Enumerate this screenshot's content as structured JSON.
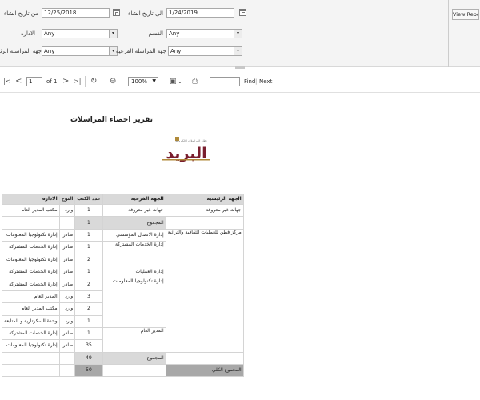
{
  "params": {
    "from_date_label": "من تاريخ انشاء",
    "from_date_value": "12/25/2018",
    "to_date_label": "الى تاريخ انشاء",
    "to_date_value": "1/24/2019",
    "department_label": "الاداره",
    "department_value": "Any",
    "section_label": "القسم",
    "section_value": "Any",
    "main_party_label": "جهه المراسله الرئيسيه",
    "main_party_value": "Any",
    "sub_party_label": "جهه المراسله الفرعيه",
    "sub_party_value": "Any",
    "view_report_label": "View Report"
  },
  "toolbar": {
    "first_page": "|<",
    "prev_page": "<",
    "page_value": "1",
    "of_label": "of 1",
    "next_page": ">",
    "last_page": ">|",
    "zoom_value": "100%",
    "find_label": "Find",
    "divider": "|",
    "next_label": "Next"
  },
  "report": {
    "title": "تقرير احصاء المراسلات",
    "logo_subtitle": "نظام المراسلات الالكترونية",
    "logo_text": "البريد",
    "headers": [
      "الجهة الرئيسية",
      "الجهة الفرعية",
      "عدد الكتب",
      "النوع",
      "الاداره"
    ],
    "rows": [
      {
        "main": "جهات غير معروفة",
        "sub": "جهات غير معروفة",
        "count": "1",
        "type": "وارد",
        "dept": "مكتب المدير العام"
      },
      {
        "summary": true,
        "label": "المجموع",
        "count": "1"
      },
      {
        "main": "مركز فطن للعمليات الثقافية والتراثية",
        "sub": "إدارة الاتصال المؤسسي",
        "count": "1",
        "type": "صادر",
        "dept": "إدارة تكنولوجيا المعلومات"
      },
      {
        "main": "",
        "sub": "إدارة الخدمات المشتركة",
        "count": "1",
        "type": "صادر",
        "dept": "إدارة الخدمات المشتركة"
      },
      {
        "main": "",
        "sub": "",
        "count": "2",
        "type": "صادر",
        "dept": "إدارة تكنولوجيا المعلومات"
      },
      {
        "main": "",
        "sub": "إدارة العمليات",
        "count": "1",
        "type": "صادر",
        "dept": "إدارة الخدمات المشتركة"
      },
      {
        "main": "",
        "sub": "إدارة تكنولوجيا المعلومات",
        "count": "2",
        "type": "صادر",
        "dept": "إدارة الخدمات المشتركة"
      },
      {
        "main": "",
        "sub": "",
        "count": "3",
        "type": "وارد",
        "dept": "المدير العام"
      },
      {
        "main": "",
        "sub": "",
        "count": "2",
        "type": "وارد",
        "dept": "مكتب المدير العام"
      },
      {
        "main": "",
        "sub": "",
        "count": "1",
        "type": "وارد",
        "dept": "وحدة السكرتارية و المتابعة"
      },
      {
        "main": "",
        "sub": "المدير العام",
        "count": "1",
        "type": "صادر",
        "dept": "إدارة الخدمات المشتركة"
      },
      {
        "main": "",
        "sub": "",
        "count": "35",
        "type": "صادر",
        "dept": "إدارة تكنولوجيا المعلومات"
      },
      {
        "summary": true,
        "label": "المجموع",
        "count": "49"
      },
      {
        "grand": true,
        "label": "المجموع الكلي",
        "count": "50"
      }
    ]
  }
}
